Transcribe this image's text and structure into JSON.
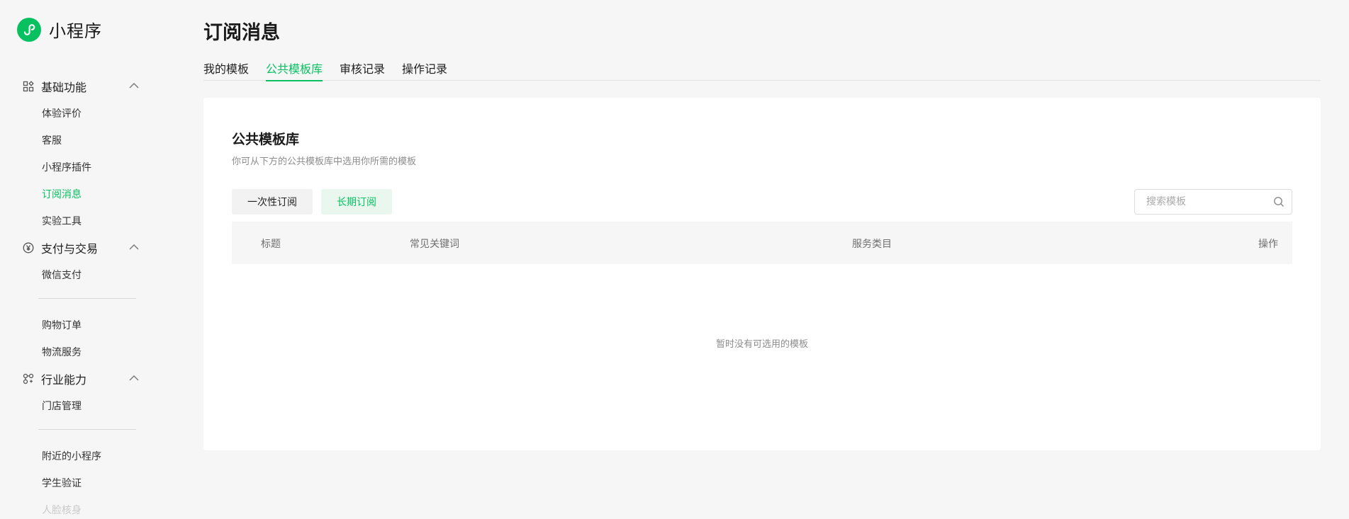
{
  "brand": {
    "name": "小程序",
    "accent": "#07c160"
  },
  "sidebar": {
    "groups": [
      {
        "label": "基础功能",
        "icon": "grid-icon",
        "items": [
          {
            "label": "体验评价"
          },
          {
            "label": "客服"
          },
          {
            "label": "小程序插件"
          },
          {
            "label": "订阅消息",
            "active": true
          },
          {
            "label": "实验工具"
          }
        ]
      },
      {
        "label": "支付与交易",
        "icon": "yen-icon",
        "items": [
          {
            "label": "微信支付"
          },
          {
            "label": "购物订单"
          },
          {
            "label": "物流服务"
          }
        ]
      },
      {
        "label": "行业能力",
        "icon": "nodes-icon",
        "items": [
          {
            "label": "门店管理"
          },
          {
            "label": "附近的小程序"
          },
          {
            "label": "学生验证"
          },
          {
            "label": "人脸核身"
          }
        ]
      }
    ]
  },
  "page": {
    "title": "订阅消息",
    "tabs": [
      {
        "label": "我的模板"
      },
      {
        "label": "公共模板库",
        "active": true
      },
      {
        "label": "审核记录"
      },
      {
        "label": "操作记录"
      }
    ]
  },
  "card": {
    "title": "公共模板库",
    "description": "你可从下方的公共模板库中选用你所需的模板",
    "filters": [
      {
        "label": "一次性订阅"
      },
      {
        "label": "长期订阅",
        "active": true
      }
    ],
    "search_placeholder": "搜索模板",
    "table": {
      "columns": [
        "标题",
        "常见关键词",
        "服务类目",
        "操作"
      ]
    },
    "empty_text": "暂时没有可选用的模板"
  }
}
